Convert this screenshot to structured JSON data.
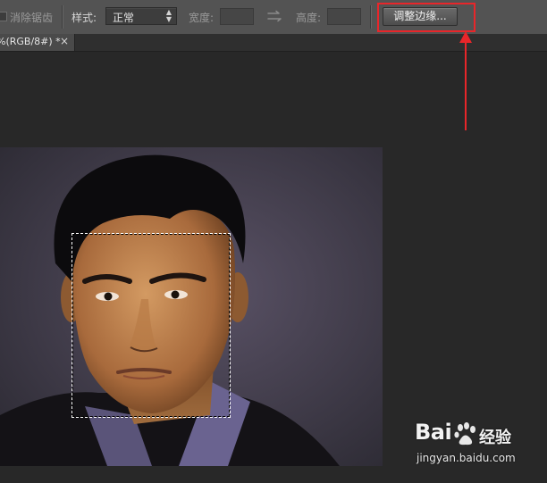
{
  "options_bar": {
    "anti_alias_label": "消除锯齿",
    "style_label": "样式:",
    "style_value": "正常",
    "width_label": "宽度:",
    "width_value": "",
    "height_label": "高度:",
    "height_value": "",
    "refine_edge_label": "调整边缘..."
  },
  "document_tab": {
    "title": "%(RGB/8#) *",
    "close_glyph": "×"
  },
  "annotation": {
    "highlight_color": "#e8262a",
    "arrow_color": "#e8262a"
  },
  "watermark": {
    "brand": "Bai",
    "brand_suffix": "经验",
    "url": "jingyan.baidu.com"
  }
}
